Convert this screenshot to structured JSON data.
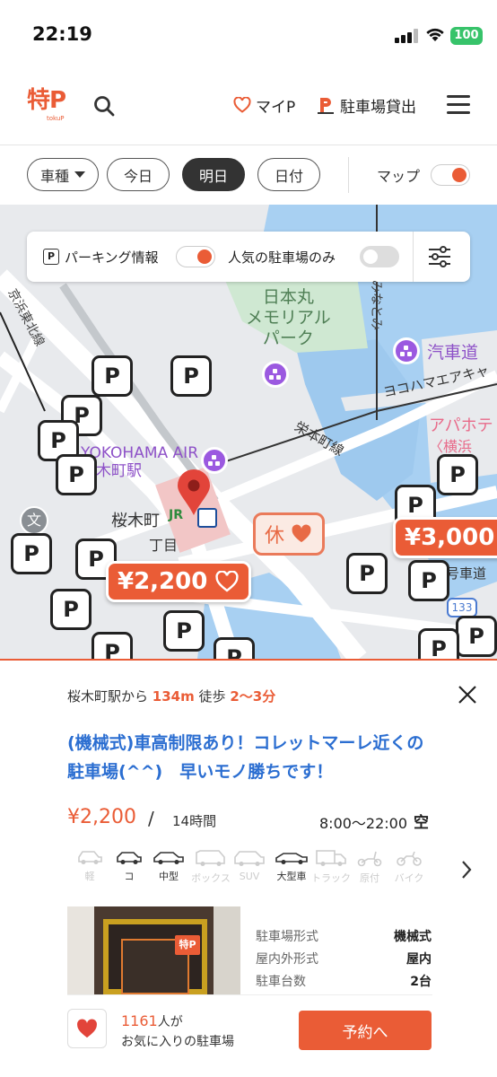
{
  "status": {
    "time": "22:19",
    "battery": "100"
  },
  "header": {
    "logo_text": "特P",
    "logo_sub": "tokuP",
    "mypage_label": "マイP",
    "rent_label": "駐車場貸出"
  },
  "filters": {
    "vehicle_label": "車種",
    "today_label": "今日",
    "tomorrow_label": "明日",
    "date_label": "日付",
    "map_label": "マップ",
    "map_toggle_on": true
  },
  "map": {
    "parking_info_label": "パーキング情報",
    "popular_only_label": "人気の駐車場のみ",
    "places": {
      "nipponmaru": "日本丸\nメモリアル\nパーク",
      "kisha": "汽車道",
      "yokohama_air": "ヨコハマエアキャ",
      "apa": "アパホテ",
      "yokohama": "〈横浜",
      "sakuragicho": "桜木町",
      "yokohama_air_sta": "YOKOHAMA AIR\n桜木町駅",
      "keihin_tohoku": "京浜東北線",
      "minatomirai": "みなとみ",
      "eiyo_line": "栄本町線",
      "chome": "丁目",
      "route_shield": "133",
      "road_label": "号車道",
      "bun_symbol": "文",
      "jr_label": "JR",
      "p_symbol": "P"
    },
    "price_tags": [
      "¥2,200",
      "¥3,000"
    ],
    "closed_label": "休"
  },
  "sheet": {
    "route_prefix": "桜木町駅から",
    "distance": "134m",
    "walk_label": "徒歩",
    "walk_time": "2〜3分",
    "title": "(機械式)車高制限あり！コレットマーレ近くの駐車場(^^)　早いモノ勝ちです！",
    "price": "¥2,200",
    "slash": "/",
    "hours": "14時間",
    "open_hours": "8:00〜22:00",
    "availability": "空",
    "car_types": [
      {
        "label": "軽",
        "active": false
      },
      {
        "label": "コ",
        "active": true
      },
      {
        "label": "中型",
        "active": true
      },
      {
        "label": "ボックス",
        "active": false
      },
      {
        "label": "SUV",
        "active": false
      },
      {
        "label": "大型車",
        "active": true
      },
      {
        "label": "トラック",
        "active": false
      },
      {
        "label": "原付",
        "active": false
      },
      {
        "label": "バイク",
        "active": false
      }
    ],
    "specs": [
      {
        "k": "駐車場形式",
        "v": "機械式"
      },
      {
        "k": "屋内外形式",
        "v": "屋内"
      },
      {
        "k": "駐車台数",
        "v": "2台"
      }
    ],
    "photo_logo": "特P",
    "fav_count": "1161",
    "fav_suffix": "人が",
    "fav_line2": "お気に入りの駐車場",
    "reserve_label": "予約へ"
  },
  "colors": {
    "accent": "#ea5c36",
    "title_blue": "#2b6ed1",
    "poi_purple": "#9b59e0"
  }
}
